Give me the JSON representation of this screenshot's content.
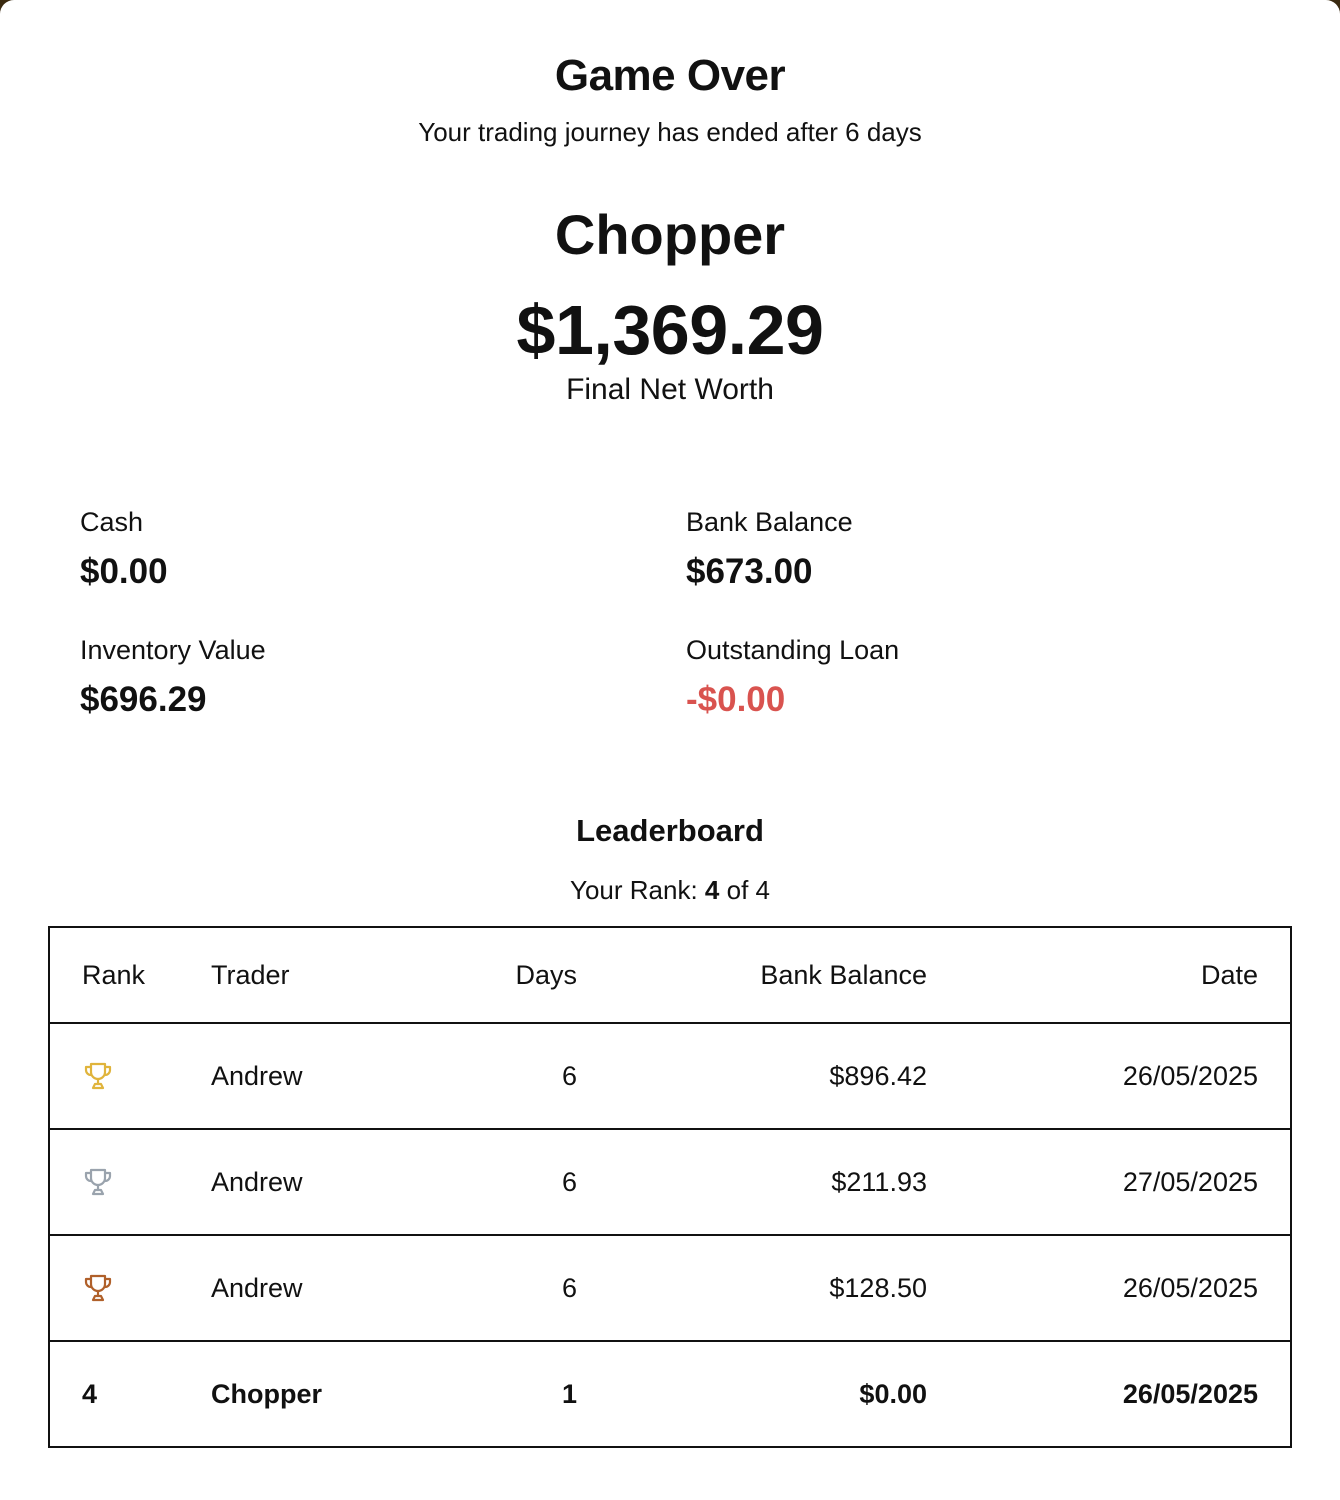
{
  "header": {
    "title": "Game Over",
    "subtitle": "Your trading journey has ended after 6 days"
  },
  "player": {
    "name": "Chopper",
    "net_worth": "$1,369.29",
    "net_worth_label": "Final Net Worth"
  },
  "stats": {
    "cash_label": "Cash",
    "cash_value": "$0.00",
    "bank_label": "Bank Balance",
    "bank_value": "$673.00",
    "inventory_label": "Inventory Value",
    "inventory_value": "$696.29",
    "loan_label": "Outstanding Loan",
    "loan_value": "-$0.00",
    "loan_color": "#d9534f"
  },
  "leaderboard": {
    "title": "Leaderboard",
    "rank_prefix": "Your Rank:",
    "rank_value": "4",
    "rank_suffix": "of 4",
    "columns": {
      "rank": "Rank",
      "trader": "Trader",
      "days": "Days",
      "bank": "Bank Balance",
      "date": "Date"
    },
    "rows": [
      {
        "rank_icon": "gold-trophy-icon",
        "icon_color": "#e0b43c",
        "trader": "Andrew",
        "days": "6",
        "bank": "$896.42",
        "date": "26/05/2025"
      },
      {
        "rank_icon": "silver-trophy-icon",
        "icon_color": "#9aa3ad",
        "trader": "Andrew",
        "days": "6",
        "bank": "$211.93",
        "date": "27/05/2025"
      },
      {
        "rank_icon": "bronze-trophy-icon",
        "icon_color": "#b0602a",
        "trader": "Andrew",
        "days": "6",
        "bank": "$128.50",
        "date": "26/05/2025"
      },
      {
        "rank": "4",
        "trader": "Chopper",
        "days": "1",
        "bank": "$0.00",
        "date": "26/05/2025",
        "current": true
      }
    ]
  }
}
